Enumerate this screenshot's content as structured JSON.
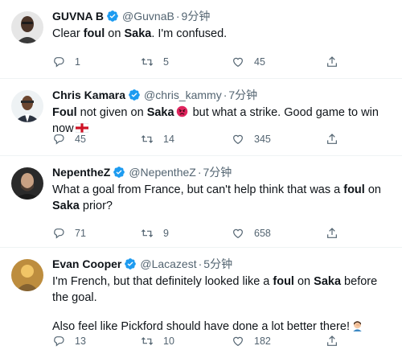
{
  "tweets": [
    {
      "name": "GUVNA B",
      "handle": "@GuvnaB",
      "separator": "·",
      "time": "9分钟",
      "avatar_icon": "profile-photo",
      "text_parts": [
        {
          "t": "Clear ",
          "b": false
        },
        {
          "t": "foul",
          "b": true
        },
        {
          "t": " on ",
          "b": false
        },
        {
          "t": "Saka",
          "b": true
        },
        {
          "t": ". I'm confused.",
          "b": false
        }
      ],
      "replies": "1",
      "retweets": "5",
      "likes": "45"
    },
    {
      "name": "Chris Kamara",
      "handle": "@chris_kammy",
      "separator": "·",
      "time": "7分钟",
      "avatar_icon": "profile-photo",
      "text_a": "Foul",
      "text_b": " not given on ",
      "text_c": "Saka",
      "emoji_1": "angry-face-emoji",
      "text_d": " but what a strike. Good game to win now",
      "emoji_2": "england-flag-emoji",
      "replies": "45",
      "retweets": "14",
      "likes": "345"
    },
    {
      "name": "NepentheZ",
      "handle": "@NepentheZ",
      "separator": "·",
      "time": "7分钟",
      "avatar_icon": "profile-photo",
      "text_a": "What a goal from France, but can't help think that was a ",
      "text_b": "foul",
      "text_c": " on ",
      "text_d": "Saka",
      "text_e": " prior?",
      "replies": "71",
      "retweets": "9",
      "likes": "658"
    },
    {
      "name": "Evan Cooper",
      "handle": "@Lacazest",
      "separator": "·",
      "time": "5分钟",
      "avatar_icon": "profile-photo",
      "text_a": "I'm French, but that definitely looked like a ",
      "text_b": "foul",
      "text_c": " on ",
      "text_d": "Saka",
      "text_e": " before the goal.",
      "text_f": "Also feel like Pickford should have done a lot better there!",
      "emoji": "man-facepalming-emoji",
      "replies": "13",
      "retweets": "10",
      "likes": "182"
    }
  ],
  "colors": {
    "verified": "#1d9bf0",
    "text": "#0f1419",
    "secondary": "#536471",
    "divider": "#eff3f4"
  },
  "icons": {
    "verified": "verified-badge-icon",
    "more": "more-options-icon",
    "reply": "reply-icon",
    "retweet": "retweet-icon",
    "like": "like-icon",
    "share": "share-icon"
  }
}
